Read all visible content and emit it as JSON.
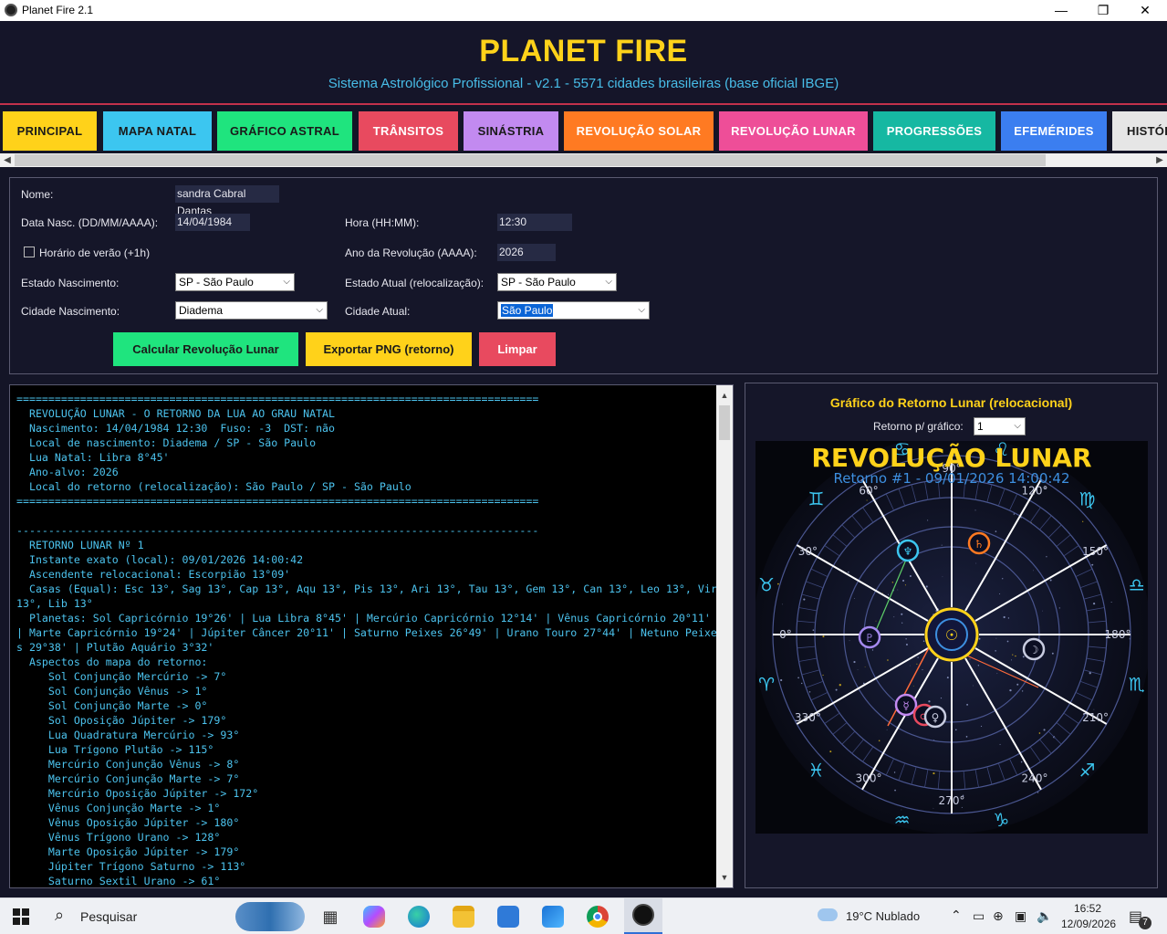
{
  "window": {
    "title": "Planet Fire 2.1",
    "minimize": "—",
    "maximize": "❐",
    "close": "✕"
  },
  "header": {
    "title": "PLANET FIRE",
    "subtitle": "Sistema Astrológico Profissional - v2.1 - 5571 cidades brasileiras (base oficial IBGE)"
  },
  "tabs": [
    {
      "label": "PRINCIPAL",
      "bg": "#ffd21a",
      "fg": "#1a1a1a"
    },
    {
      "label": "MAPA NATAL",
      "bg": "#3cc6f0",
      "fg": "#1a1a1a"
    },
    {
      "label": "GRÁFICO ASTRAL",
      "bg": "#1fe47e",
      "fg": "#1a1a1a"
    },
    {
      "label": "TRÂNSITOS",
      "bg": "#e84a5f",
      "fg": "#ffffff"
    },
    {
      "label": "SINÁSTRIA",
      "bg": "#c28af0",
      "fg": "#1a1a1a"
    },
    {
      "label": "REVOLUÇÃO SOLAR",
      "bg": "#ff7a22",
      "fg": "#ffffff"
    },
    {
      "label": "REVOLUÇÃO LUNAR",
      "bg": "#ee4e98",
      "fg": "#ffffff"
    },
    {
      "label": "PROGRESSÕES",
      "bg": "#16b8a2",
      "fg": "#ffffff"
    },
    {
      "label": "EFEMÉRIDES",
      "bg": "#3b7ef0",
      "fg": "#ffffff"
    },
    {
      "label": "HISTÓRICO",
      "bg": "#e6e6e6",
      "fg": "#1a1a1a"
    }
  ],
  "form": {
    "name_label": "Nome:",
    "name_value": "sandra Cabral Dantas",
    "birth_date_label": "Data Nasc. (DD/MM/AAAA):",
    "birth_date_value": "14/04/1984",
    "time_label": "Hora (HH:MM):",
    "time_value": "12:30",
    "dst_label": "Horário de verão (+1h)",
    "year_label": "Ano da Revolução (AAAA):",
    "year_value": "2026",
    "birth_state_label": "Estado Nascimento:",
    "birth_state_value": "SP - São Paulo",
    "current_state_label": "Estado Atual (relocalização):",
    "current_state_value": "SP - São Paulo",
    "birth_city_label": "Cidade Nascimento:",
    "birth_city_value": "Diadema",
    "current_city_label": "Cidade Atual:",
    "current_city_value": "São Paulo",
    "calc_button": "Calcular Revolução Lunar",
    "export_button": "Exportar PNG (retorno)",
    "clear_button": "Limpar"
  },
  "output": {
    "lines": [
      "==================================================================================",
      "  REVOLUÇÃO LUNAR - O RETORNO DA LUA AO GRAU NATAL",
      "  Nascimento: 14/04/1984 12:30  Fuso: -3  DST: não",
      "  Local de nascimento: Diadema / SP - São Paulo",
      "  Lua Natal: Libra 8°45'",
      "  Ano-alvo: 2026",
      "  Local do retorno (relocalização): São Paulo / SP - São Paulo",
      "==================================================================================",
      "",
      "----------------------------------------------------------------------------------",
      "  RETORNO LUNAR Nº 1",
      "  Instante exato (local): 09/01/2026 14:00:42",
      "  Ascendente relocacional: Escorpião 13°09'",
      "  Casas (Equal): Esc 13°, Sag 13°, Cap 13°, Aqu 13°, Pis 13°, Ari 13°, Tau 13°, Gem 13°, Can 13°, Leo 13°, Vir 13°, Lib 13°",
      "  Planetas: Sol Capricórnio 19°26' | Lua Libra 8°45' | Mercúrio Capricórnio 12°14' | Vênus Capricórnio 20°11' | Marte Capricórnio 19°24' | Júpiter Câncer 20°11' | Saturno Peixes 26°49' | Urano Touro 27°44' | Netuno Peixes 29°38' | Plutão Aquário 3°32'",
      "  Aspectos do mapa do retorno:",
      "     Sol Conjunção Mercúrio -> 7°",
      "     Sol Conjunção Vênus -> 1°",
      "     Sol Conjunção Marte -> 0°",
      "     Sol Oposição Júpiter -> 179°",
      "     Lua Quadratura Mercúrio -> 93°",
      "     Lua Trígono Plutão -> 115°",
      "     Mercúrio Conjunção Vênus -> 8°",
      "     Mercúrio Conjunção Marte -> 7°",
      "     Mercúrio Oposição Júpiter -> 172°",
      "     Vênus Conjunção Marte -> 1°",
      "     Vênus Oposição Júpiter -> 180°",
      "     Vênus Trígono Urano -> 128°",
      "     Marte Oposição Júpiter -> 179°",
      "     Júpiter Trígono Saturno -> 113°",
      "     Saturno Sextil Urano -> 61°"
    ]
  },
  "chart_panel": {
    "title": "Gráfico do Retorno Lunar (relocacional)",
    "select_label": "Retorno p/ gráfico:",
    "select_value": "1",
    "chart_heading": "REVOLUÇÃO LUNAR",
    "chart_subheading": "Retorno #1 - 09/01/2026 14:00:42",
    "degree_labels": [
      "0°",
      "30°",
      "60°",
      "90°",
      "120°",
      "150°",
      "180°",
      "210°",
      "240°",
      "270°",
      "300°",
      "330°"
    ],
    "zodiac_glyphs": [
      "♈",
      "♉",
      "♊",
      "♋",
      "♌",
      "♍",
      "♎",
      "♏",
      "♐",
      "♑",
      "♒",
      "♓"
    ],
    "planet_glyphs": {
      "sun": "☉",
      "moon": "☽",
      "mercury": "☿",
      "venus": "♀",
      "mars": "♂",
      "jupiter": "♃",
      "saturn": "♄",
      "uranus": "♅",
      "neptune": "♆",
      "pluto": "♇"
    }
  },
  "taskbar": {
    "search_label": "Pesquisar",
    "weather": "19°C  Nublado",
    "time": "16:52",
    "date": "12/09/2026",
    "notification_count": "7"
  }
}
